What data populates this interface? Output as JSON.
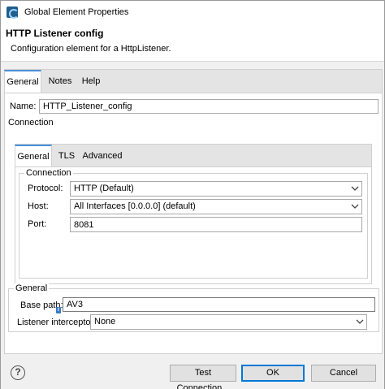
{
  "window": {
    "title": "Global Element Properties"
  },
  "header": {
    "title": "HTTP Listener config",
    "description": "Configuration element for a HttpListener."
  },
  "outer_tabs": [
    {
      "label": "General",
      "active": true
    },
    {
      "label": "Notes",
      "active": false
    },
    {
      "label": "Help",
      "active": false
    }
  ],
  "name_field": {
    "label": "Name:",
    "value": "HTTP_Listener_config"
  },
  "connection_section": {
    "label": "Connection"
  },
  "inner_tabs": [
    {
      "label": "General",
      "active": true
    },
    {
      "label": "TLS",
      "active": false
    },
    {
      "label": "Advanced",
      "active": false
    }
  ],
  "connection_group": {
    "legend": "Connection",
    "protocol": {
      "label": "Protocol:",
      "value": "HTTP (Default)"
    },
    "host": {
      "label": "Host:",
      "value": "All Interfaces [0.0.0.0] (default)"
    },
    "port": {
      "label": "Port:",
      "value": "8081"
    }
  },
  "general_group": {
    "legend": "General",
    "base_path": {
      "label": "Base path:",
      "value": "AV3"
    },
    "interceptors": {
      "label": "Listener interceptors",
      "value": "None"
    }
  },
  "footer": {
    "test_connection_label": "Test Connection...",
    "ok_label": "OK",
    "cancel_label": "Cancel"
  },
  "icons": {
    "app": "mule-app-icon",
    "help": "help-icon",
    "dropdown": "chevron-down-icon",
    "info": "info-icon"
  },
  "colors": {
    "active_tab_accent": "#4a90d9",
    "default_button_border": "#0078d7"
  }
}
